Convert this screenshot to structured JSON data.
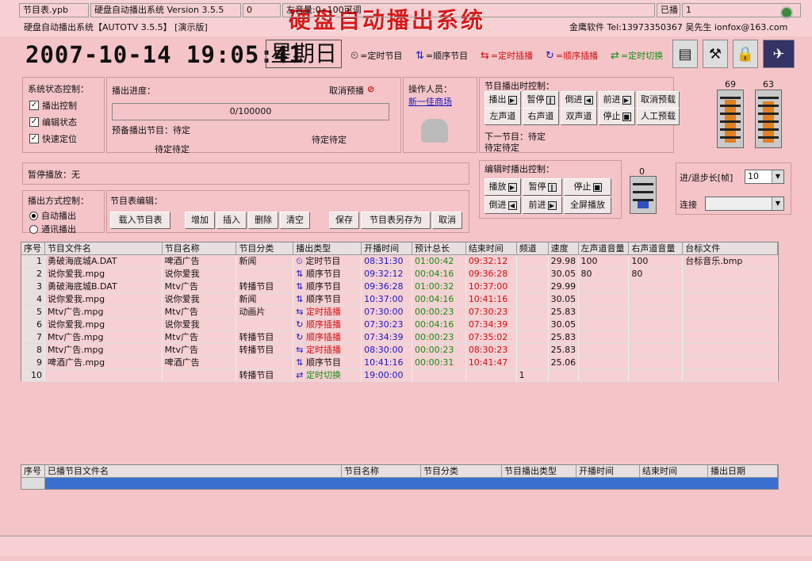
{
  "window": {
    "sys_name": "硬盘自动播出系统【AUTOTV 3.5.5】 [演示版]",
    "big_title": "硬盘自动播出系统",
    "company": "金鹰软件 Tel:13973350367 吴先生  ionfox@163.com"
  },
  "clock": {
    "datetime": "2007-10-14 19:05:41",
    "weekday": "星期日"
  },
  "legend": [
    {
      "icon": "clock-icon",
      "glyph": "⏲",
      "label": "=定时节目",
      "color": "#111111"
    },
    {
      "icon": "sequence-icon",
      "glyph": "⇅",
      "label": "=顺序节目",
      "color": "#111111"
    },
    {
      "icon": "timed-insert-icon",
      "glyph": "⇆",
      "label": "=定时插播",
      "color": "#d01010"
    },
    {
      "icon": "seq-insert-icon",
      "glyph": "↻",
      "label": "=顺序插播",
      "color": "#d01010"
    },
    {
      "icon": "timed-switch-icon",
      "glyph": "⇄",
      "label": "=定时切换",
      "color": "#109010"
    }
  ],
  "status_ctrl": {
    "title": "系统状态控制：",
    "items": [
      {
        "label": "播出控制",
        "checked": true
      },
      {
        "label": "编辑状态",
        "checked": true
      },
      {
        "label": "快速定位",
        "checked": true
      }
    ]
  },
  "progress": {
    "title": "播出进度：",
    "cancel": "取消预播",
    "value": "0/100000",
    "prep_label": "预备播出节目：待定",
    "prep_a": "待定待定",
    "prep_b": "待定待定"
  },
  "operator": {
    "title": "操作人员：",
    "name": "新一佳商场"
  },
  "play_ctrl": {
    "title": "节目播出时控制：",
    "buttons": [
      "播出",
      "暂停",
      "倒进",
      "前进",
      "取消预载",
      "左声道",
      "右声道",
      "双声道",
      "停止",
      "人工预载"
    ],
    "next_label": "下一节目：待定",
    "next_value": "待定待定"
  },
  "gauges": {
    "left": "69",
    "right": "63",
    "edit": "0"
  },
  "pause": {
    "label": "暂停播放：无"
  },
  "edit_ctrl": {
    "title": "编辑时播出控制：",
    "buttons": [
      "播放",
      "暂停",
      "停止",
      "倒进",
      "前进",
      "全屏播放"
    ]
  },
  "step": {
    "label": "进/退步长[帧]",
    "value": "10",
    "connect_label": "连接"
  },
  "mode_ctrl": {
    "title": "播出方式控制：",
    "items": [
      {
        "label": "自动播出",
        "selected": true
      },
      {
        "label": "通讯播出",
        "selected": false
      }
    ]
  },
  "schedule_edit": {
    "title": "节目表编辑：",
    "buttons": [
      "载入节目表",
      "增加",
      "插入",
      "删除",
      "清空",
      "保存",
      "节目表另存为",
      "取消"
    ]
  },
  "table": {
    "headers": [
      "序号",
      "节目文件名",
      "节目名称",
      "节目分类",
      "播出类型",
      "开播时间",
      "预计总长",
      "结束时间",
      "频道",
      "速度",
      "左声道音量",
      "右声道音量",
      "台标文件"
    ],
    "rows": [
      [
        "1",
        "勇破海底城A.DAT",
        "啤酒广告",
        "新闻",
        "定时节目",
        "08:31:30",
        "01:00:42",
        "09:32:12",
        "",
        "29.98",
        "100",
        "100",
        "台标音乐.bmp"
      ],
      [
        "2",
        "说你爱我.mpg",
        "说你爱我",
        "",
        "顺序节目",
        "09:32:12",
        "00:04:16",
        "09:36:28",
        "",
        "30.05",
        "80",
        "80",
        ""
      ],
      [
        "3",
        "勇破海底城B.DAT",
        "Mtv广告",
        "转播节目",
        "顺序节目",
        "09:36:28",
        "01:00:32",
        "10:37:00",
        "",
        "29.99",
        "",
        "",
        ""
      ],
      [
        "4",
        "说你爱我.mpg",
        "说你爱我",
        "新闻",
        "顺序节目",
        "10:37:00",
        "00:04:16",
        "10:41:16",
        "",
        "30.05",
        "",
        "",
        ""
      ],
      [
        "5",
        "Mtv广告.mpg",
        "Mtv广告",
        "动画片",
        "定时插播",
        "07:30:00",
        "00:00:23",
        "07:30:23",
        "",
        "25.83",
        "",
        "",
        ""
      ],
      [
        "6",
        "说你爱我.mpg",
        "说你爱我",
        "",
        "顺序插播",
        "07:30:23",
        "00:04:16",
        "07:34:39",
        "",
        "30.05",
        "",
        "",
        ""
      ],
      [
        "7",
        "Mtv广告.mpg",
        "Mtv广告",
        "转播节目",
        "顺序插播",
        "07:34:39",
        "00:00:23",
        "07:35:02",
        "",
        "25.83",
        "",
        "",
        ""
      ],
      [
        "8",
        "Mtv广告.mpg",
        "Mtv广告",
        "转播节目",
        "定时插播",
        "08:30:00",
        "00:00:23",
        "08:30:23",
        "",
        "25.83",
        "",
        "",
        ""
      ],
      [
        "9",
        "啤酒广告.mpg",
        "啤酒广告",
        "",
        "顺序节目",
        "10:41:16",
        "00:00:31",
        "10:41:47",
        "",
        "25.06",
        "",
        "",
        ""
      ],
      [
        "10",
        "",
        "",
        "转播节目",
        "定时切换",
        "19:00:00",
        "",
        "",
        "1",
        "",
        "",
        "",
        ""
      ]
    ]
  },
  "played_table": {
    "headers": [
      "序号",
      "已播节目文件名",
      "节目名称",
      "节目分类",
      "节目播出类型",
      "开播时间",
      "结束时间",
      "播出日期"
    ]
  },
  "statusbar": {
    "file": "节目表.ypb",
    "version": "硬盘自动播出系统 Version 3.5.5",
    "count": "0",
    "volume": "左音量:0--100可调",
    "played_label": "已播",
    "played_value": "1"
  }
}
